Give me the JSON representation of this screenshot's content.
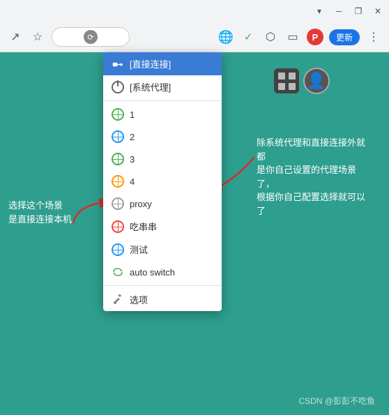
{
  "browser": {
    "titlebar": {
      "collapse_label": "▾",
      "minimize_label": "─",
      "maximize_label": "❐",
      "close_label": "✕"
    },
    "toolbar": {
      "share_icon": "↗",
      "star_icon": "☆",
      "extension_icon": "⊞",
      "check_icon": "✓",
      "puzzle_icon": "⬡",
      "window_icon": "▭",
      "update_label": "更新",
      "menu_icon": "⋮"
    }
  },
  "dropdown": {
    "items": [
      {
        "id": "direct",
        "label": "[直接连接]",
        "icon": "direct",
        "active": true
      },
      {
        "id": "system",
        "label": "[系统代理]",
        "icon": "power"
      },
      {
        "id": "1",
        "label": "1",
        "icon": "globe-green"
      },
      {
        "id": "2",
        "label": "2",
        "icon": "globe-blue"
      },
      {
        "id": "3",
        "label": "3",
        "icon": "globe-green2"
      },
      {
        "id": "4",
        "label": "4",
        "icon": "globe-orange"
      },
      {
        "id": "proxy",
        "label": "proxy",
        "icon": "globe-gray"
      },
      {
        "id": "chichuanchuan",
        "label": "吃串串",
        "icon": "globe-red"
      },
      {
        "id": "test",
        "label": "测试",
        "icon": "globe-blue2"
      },
      {
        "id": "autoswitch",
        "label": "auto switch",
        "icon": "switch"
      },
      {
        "id": "options",
        "label": "选项",
        "icon": "settings"
      }
    ]
  },
  "annotations": {
    "left": "选择这个场景\n是直接连接本机",
    "right": "除系统代理和直接连接外就都\n是你自己设置的代理场景了，\n根据你自己配置选择就可以了"
  },
  "watermark": "CSDN @彭彭不吃鱼"
}
